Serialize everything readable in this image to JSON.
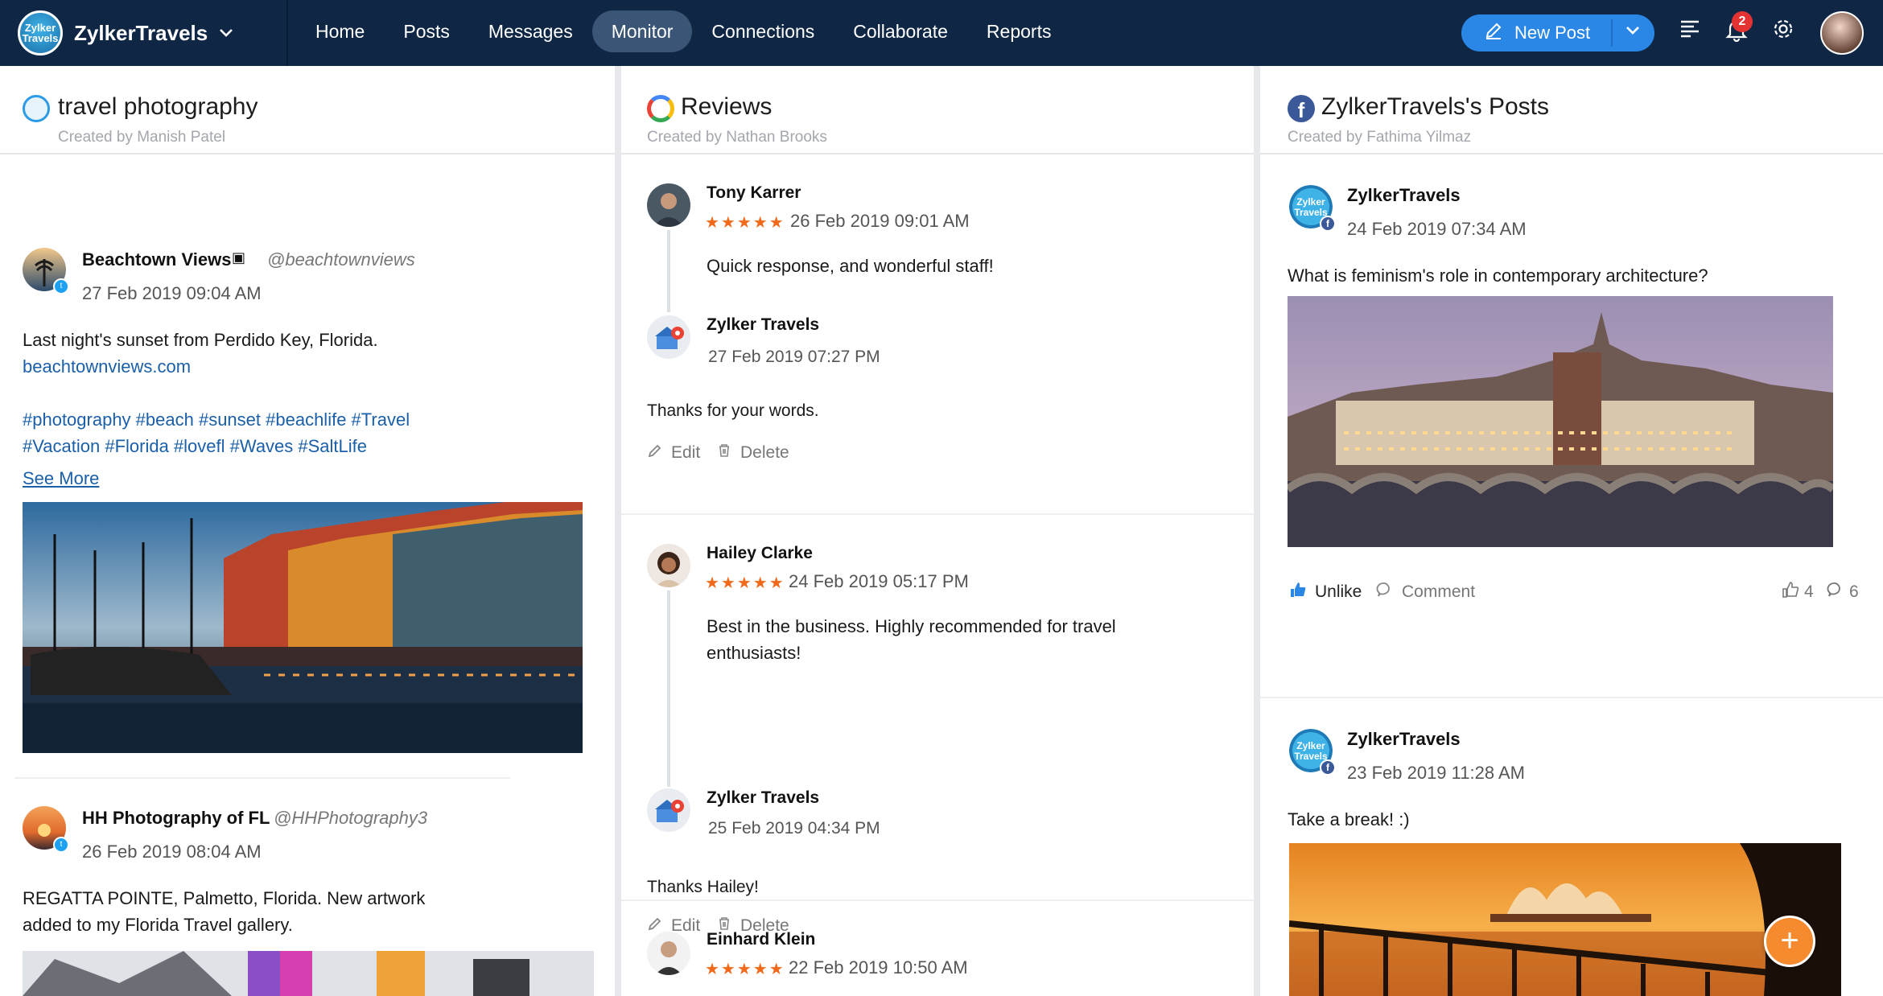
{
  "topbar": {
    "brand_name": "ZylkerTravels",
    "brand_logo_text": "Zylker Travels",
    "nav": [
      "Home",
      "Posts",
      "Messages",
      "Monitor",
      "Connections",
      "Collaborate",
      "Reports"
    ],
    "active_nav": "Monitor",
    "new_post_label": "New Post",
    "notification_count": "2"
  },
  "columns": {
    "col1": {
      "title": "travel photography",
      "subtitle": "Created by Manish Patel",
      "posts": [
        {
          "name": "Beachtown Views",
          "handle": "@beachtownviews",
          "time": "27 Feb 2019 09:04 AM",
          "text": "Last night's sunset from Perdido Key, Florida.",
          "link": "beachtownviews.com",
          "tags_line1": "#photography #beach #sunset #beachlife #Travel",
          "tags_line2": "#Vacation #Florida #lovefl #Waves #SaltLife",
          "see_more": "See More"
        },
        {
          "name": "HH Photography of FL",
          "handle": "@HHPhotography3",
          "time": "26 Feb 2019 08:04 AM",
          "text_line1": "REGATTA POINTE, Palmetto, Florida. New artwork",
          "text_line2": "added to my Florida Travel gallery."
        }
      ]
    },
    "col2": {
      "title": "Reviews",
      "subtitle": "Created by Nathan Brooks",
      "reviews": [
        {
          "name": "Tony Karrer",
          "stars": "★★★★★",
          "time": "26 Feb 2019 09:01 AM",
          "text": "Quick response, and wonderful staff!",
          "reply_name": "Zylker Travels",
          "reply_time": "27 Feb 2019 07:27 PM",
          "reply_text": "Thanks for your words."
        },
        {
          "name": "Hailey Clarke",
          "stars": "★★★★★",
          "time": "24 Feb 2019 05:17 PM",
          "text_line1": "Best in the business. Highly  recommended for travel",
          "text_line2": "enthusiasts!",
          "reply_name": "Zylker Travels",
          "reply_time": "25 Feb 2019 04:34 PM",
          "reply_text": "Thanks Hailey!"
        },
        {
          "name": "Einhard Klein",
          "stars": "★★★★★",
          "time": "22 Feb 2019 10:50 AM"
        }
      ],
      "edit_label": "Edit",
      "delete_label": "Delete"
    },
    "col3": {
      "title": "ZylkerTravels's Posts",
      "subtitle": "Created by Fathima Yilmaz",
      "posts": [
        {
          "name": "ZylkerTravels",
          "time": "24 Feb 2019 07:34 AM",
          "text": "What is feminism's role in contemporary architecture?",
          "unlike_label": "Unlike",
          "comment_label": "Comment",
          "likes": "4",
          "comments": "6"
        },
        {
          "name": "ZylkerTravels",
          "time": "23 Feb 2019 11:28 AM",
          "text": "Take a break! :)"
        }
      ]
    }
  },
  "colors": {
    "topbar": "#0f2745",
    "accent": "#2b87e6",
    "star": "#f16a1b",
    "fab": "#f58a2e"
  },
  "icons": {
    "fab": "+",
    "facebook": "f"
  }
}
